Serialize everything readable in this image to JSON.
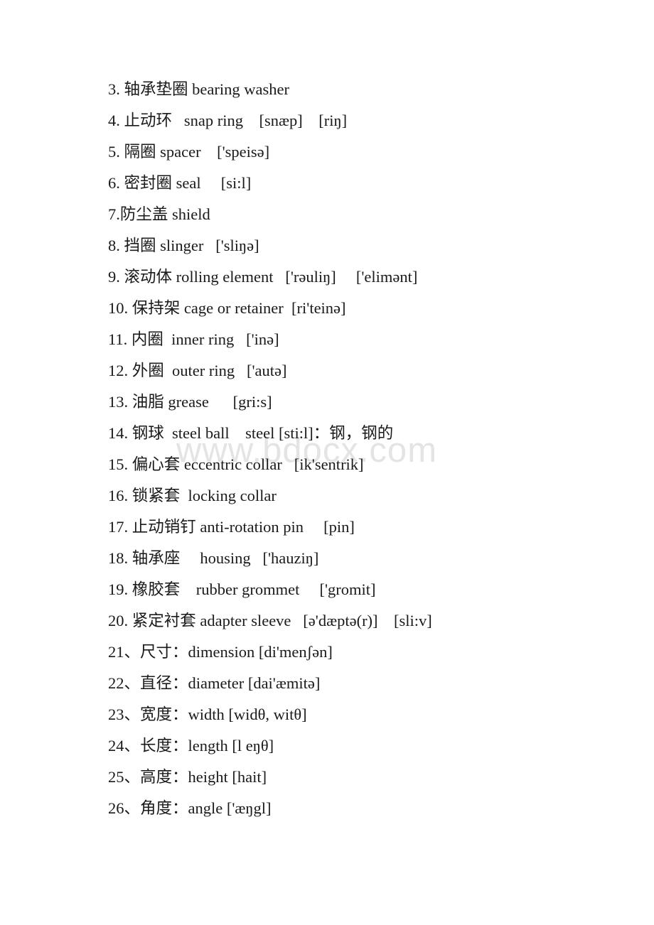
{
  "document": {
    "type": "vocabulary-list",
    "language_pair": "Chinese-English",
    "topic": "bearing components and dimensions",
    "background_color": "#ffffff",
    "text_color": "#1a1a1a"
  },
  "watermark": {
    "text": "www.bdocx.com",
    "color": "#e4e4e6"
  },
  "entries": [
    {
      "id": "entry-3",
      "text": "3. 轴承垫圈 bearing washer"
    },
    {
      "id": "entry-4",
      "text": "4. 止动环   snap ring    [snæp]    [riŋ]"
    },
    {
      "id": "entry-5",
      "text": "5. 隔圈 spacer    ['speisə]"
    },
    {
      "id": "entry-6",
      "text": "6. 密封圈 seal     [si:l]"
    },
    {
      "id": "entry-7",
      "text": "7.防尘盖 shield"
    },
    {
      "id": "entry-8",
      "text": "8. 挡圈 slinger   ['sliŋə]"
    },
    {
      "id": "entry-9",
      "text": "9. 滚动体 rolling element   ['rəuliŋ]     ['elimənt]"
    },
    {
      "id": "entry-10",
      "text": "10. 保持架 cage or retainer  [ri'teinə]"
    },
    {
      "id": "entry-11",
      "text": "11. 内圈  inner ring   ['inə]"
    },
    {
      "id": "entry-12",
      "text": "12. 外圈  outer ring   ['autə]"
    },
    {
      "id": "entry-13",
      "text": "13. 油脂 grease      [gri:s]"
    },
    {
      "id": "entry-14",
      "text": "14. 钢球  steel ball    steel [sti:l]：钢，钢的"
    },
    {
      "id": "entry-15",
      "text": "15. 偏心套 eccentric collar   [ik'sentrik]"
    },
    {
      "id": "entry-16",
      "text": "16. 锁紧套  locking collar"
    },
    {
      "id": "entry-17",
      "text": "17. 止动销钉 anti-rotation pin     [pin]"
    },
    {
      "id": "entry-18",
      "text": "18. 轴承座     housing   ['hauziŋ]"
    },
    {
      "id": "entry-19",
      "text": "19. 橡胶套    rubber grommet     ['gromit]"
    },
    {
      "id": "entry-20",
      "text": "20. 紧定衬套 adapter sleeve   [ə'dæptə(r)]    [sli:v]"
    },
    {
      "id": "entry-21",
      "text": "21、尺寸：dimension [di'menʃən]"
    },
    {
      "id": "entry-22",
      "text": "22、直径：diameter [dai'æmitə]"
    },
    {
      "id": "entry-23",
      "text": "23、宽度：width [widθ, witθ]"
    },
    {
      "id": "entry-24",
      "text": "24、长度：length [l eŋθ]"
    },
    {
      "id": "entry-25",
      "text": "25、高度：height [hait]"
    },
    {
      "id": "entry-26",
      "text": "26、角度：angle ['æŋgl]"
    }
  ]
}
